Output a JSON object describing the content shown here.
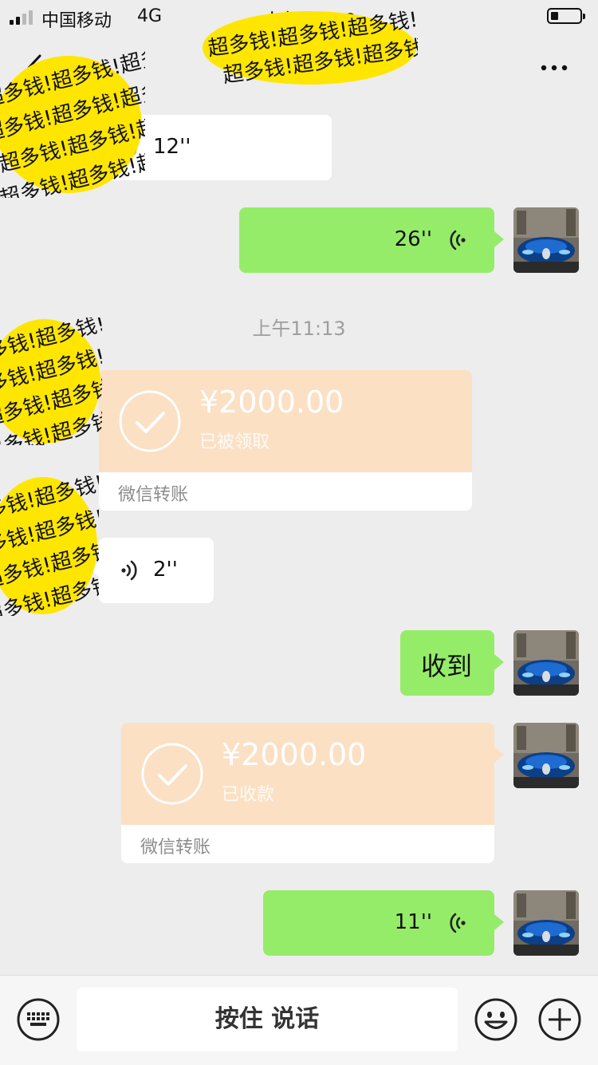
{
  "status_bar": {
    "carrier": "中国移动",
    "network": "4G",
    "time": "上午11:29"
  },
  "nav": {
    "back_icon": "chevron-left-icon",
    "more_icon": "more-dots-icon"
  },
  "stickers": {
    "text": "超多钱!超多钱!超多钱!",
    "color": "#ffe000"
  },
  "messages": {
    "m1": {
      "side": "left",
      "type": "voice",
      "duration": "12''"
    },
    "m2": {
      "side": "right",
      "type": "voice",
      "duration": "26''"
    },
    "time_separator": "上午11:13",
    "m3": {
      "side": "left",
      "type": "transfer",
      "amount": "¥2000.00",
      "status": "已被领取",
      "footer": "微信转账"
    },
    "m4": {
      "side": "left",
      "type": "voice",
      "duration": "2''"
    },
    "m5": {
      "side": "right",
      "type": "text",
      "text": "收到"
    },
    "m6": {
      "side": "right",
      "type": "transfer",
      "amount": "¥2000.00",
      "status": "已收款",
      "footer": "微信转账"
    },
    "m7": {
      "side": "right",
      "type": "voice",
      "duration": "11''"
    }
  },
  "input_bar": {
    "hold_to_talk": "按住 说话",
    "keyboard_icon": "keyboard-icon",
    "emoji_icon": "emoji-icon",
    "plus_icon": "plus-icon"
  },
  "colors": {
    "background": "#ededed",
    "green_bubble": "#95ec69",
    "transfer_card": "#fbe0c4"
  }
}
